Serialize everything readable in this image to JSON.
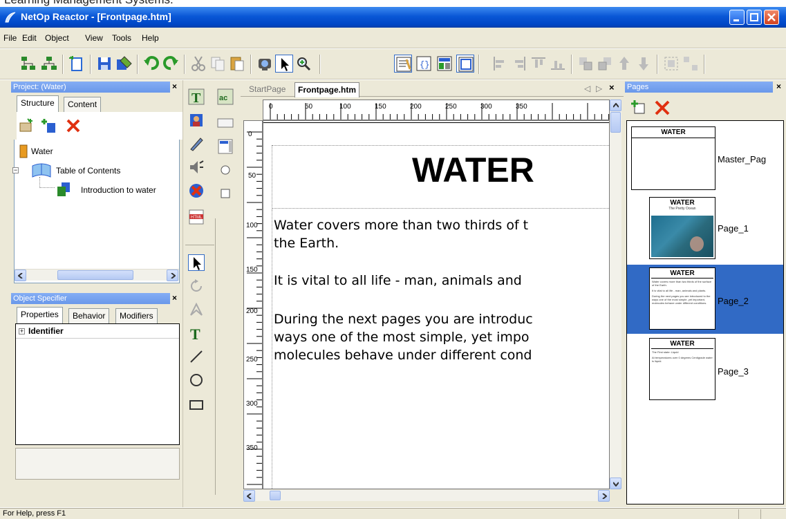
{
  "caption": "Learning Management Systems.",
  "window": {
    "title": "NetOp Reactor - [Frontpage.htm]"
  },
  "menu": [
    "File",
    "Edit",
    "Object",
    "View",
    "Tools",
    "Help"
  ],
  "project_panel": {
    "title": "Project: (Water)",
    "tabs": [
      "Structure",
      "Content"
    ],
    "tree": {
      "root": "Water",
      "toc": "Table of Contents",
      "child": "Introduction to water"
    }
  },
  "object_specifier": {
    "title": "Object Specifier",
    "tabs": [
      "Properties",
      "Behavior",
      "Modifiers"
    ],
    "identifier": "Identifier"
  },
  "editor": {
    "tabs": [
      "StartPage",
      "Frontpage.htm"
    ],
    "ruler_h": [
      "0",
      "50",
      "100",
      "150",
      "200",
      "250",
      "300",
      "350"
    ],
    "ruler_v": [
      "0",
      "50",
      "100",
      "150",
      "200",
      "250",
      "300",
      "350"
    ],
    "heading": "WATER",
    "paragraphs": [
      "Water covers more than two thirds of t",
      "the Earth.",
      "It is vital to all life - man, animals and",
      "During the next pages you are introduc",
      "ways one of the most simple, yet impo",
      "molecules behave under different cond"
    ]
  },
  "pages_panel": {
    "title": "Pages",
    "pages": [
      {
        "label": "Master_Pag",
        "thumb_title": "WATER",
        "selected": false
      },
      {
        "label": "Page_1",
        "thumb_title": "WATER",
        "thumb_subtitle": "The Pretty Ocean",
        "selected": false
      },
      {
        "label": "Page_2",
        "thumb_title": "WATER",
        "selected": true,
        "thumb_lines": [
          "Water covers more than two thirds of the surface of the Earth.",
          "It is vital to all life - man, animals and plants.",
          "During the next pages you are introduced to the ways one of the most simple, yet important, molecules behave under different conditions."
        ]
      },
      {
        "label": "Page_3",
        "thumb_title": "WATER",
        "thumb_lines": [
          "The First state: Liquid",
          "At temperatures over 0 degrees Centigrade water is liquid."
        ]
      }
    ]
  },
  "status": "For Help, press F1",
  "colors": {
    "titlebar": "#0a57d6",
    "selected": "#316ac5",
    "panel": "#ece9d8"
  }
}
